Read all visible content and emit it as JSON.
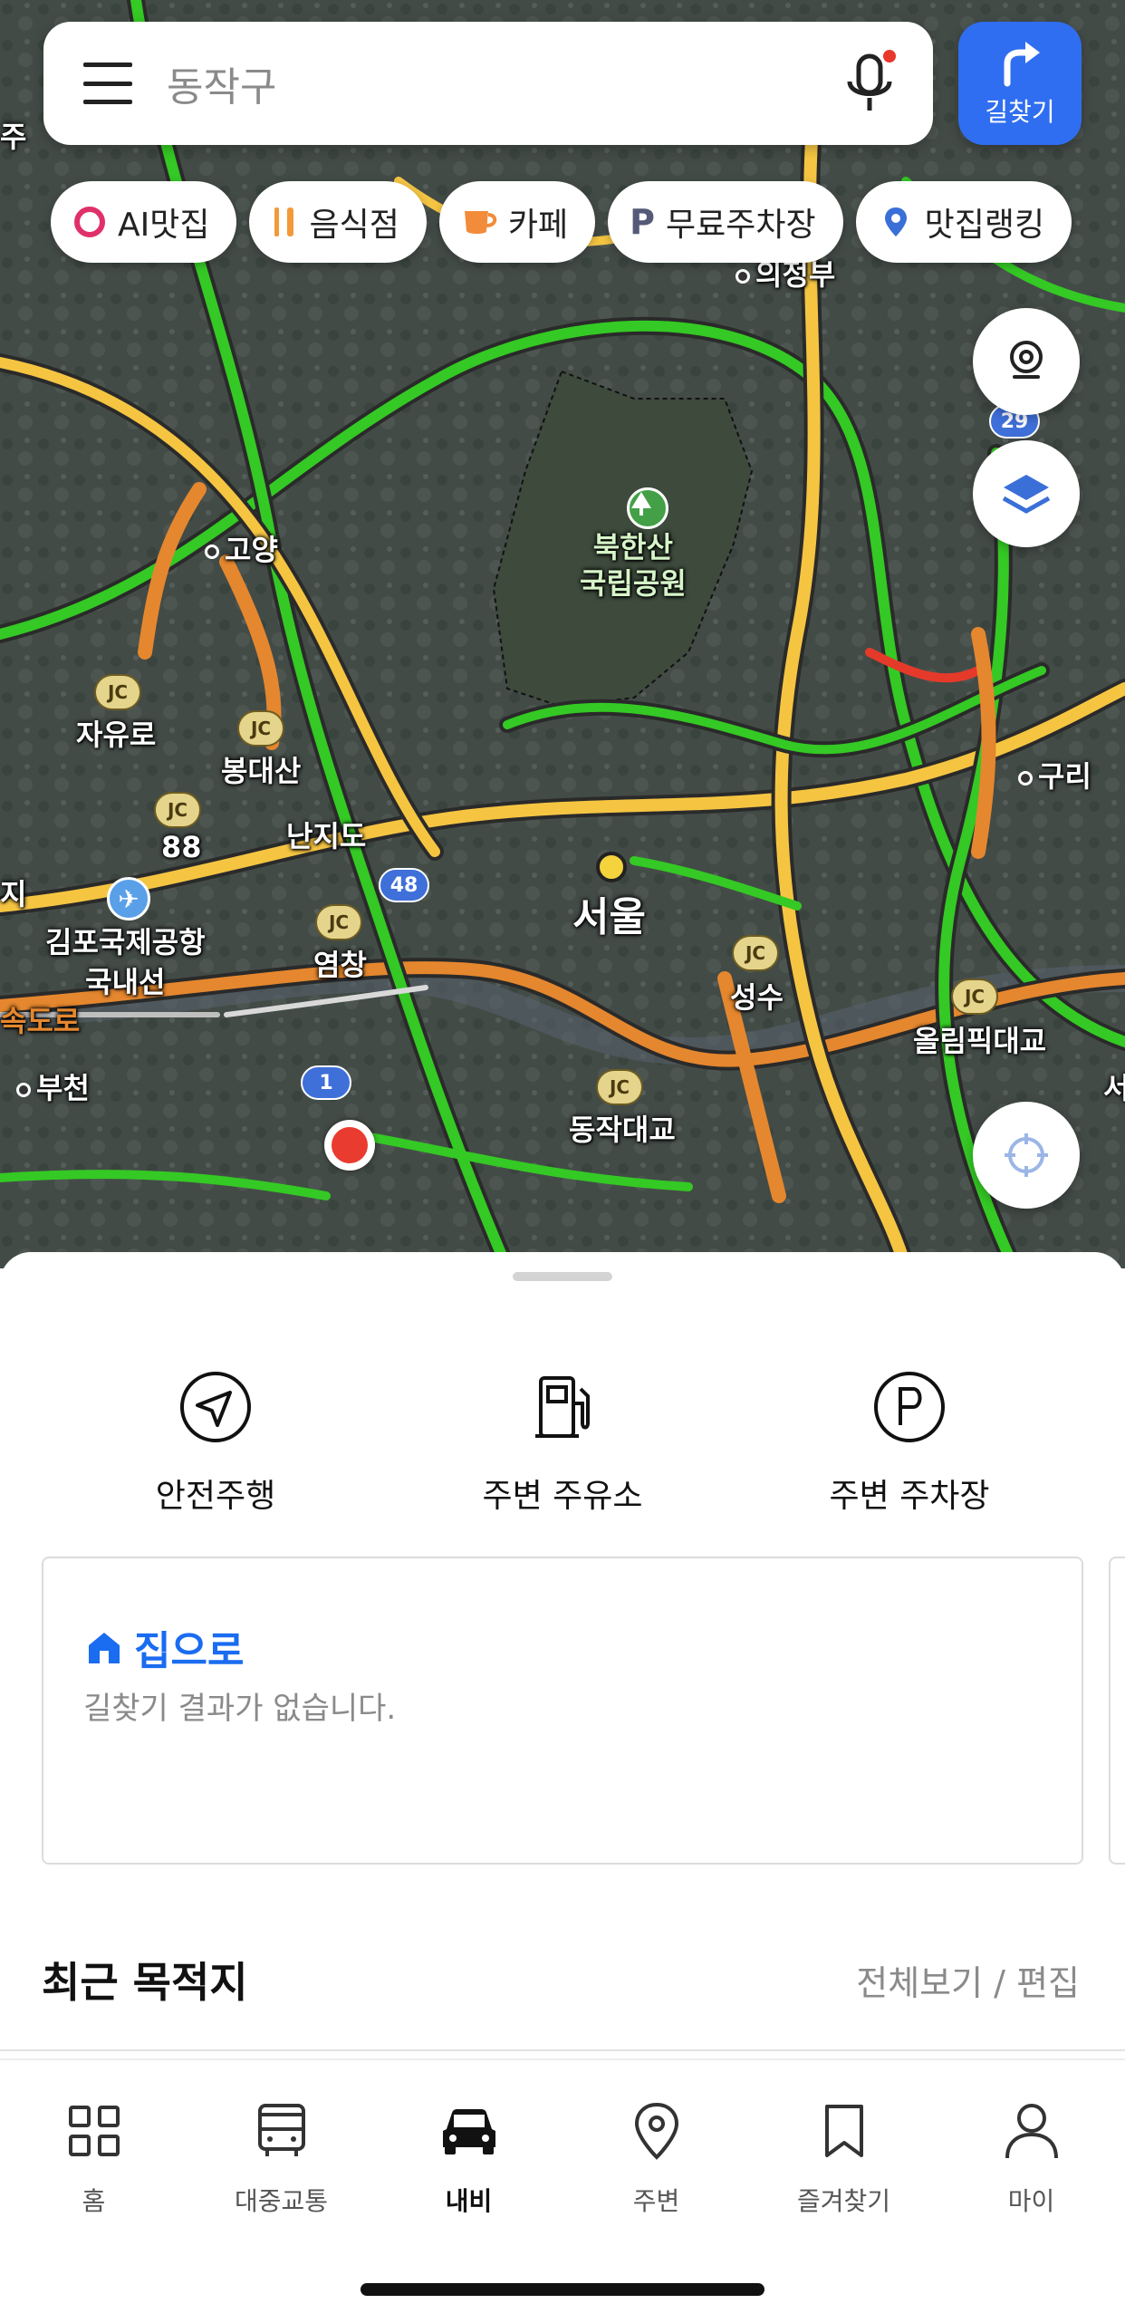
{
  "search": {
    "placeholder": "동작구"
  },
  "nav_button": {
    "label": "길찾기"
  },
  "chips": [
    {
      "icon": "ai-ring-icon",
      "label": "AI맛집"
    },
    {
      "icon": "fork-knife-icon",
      "label": "음식점"
    },
    {
      "icon": "coffee-cup-icon",
      "label": "카페"
    },
    {
      "icon": "parking-p-icon",
      "label": "무료주차장"
    },
    {
      "icon": "ranking-pin-icon",
      "label": "맛집랭킹"
    }
  ],
  "map": {
    "labels": {
      "goyang": "고양",
      "bukhansan": "북한산\n국립공원",
      "uijeongbu": "의정부",
      "jayuro": "자유로",
      "bongdaesan": "봉대산",
      "guri": "구리",
      "nanjido": "난지도",
      "seoul": "서울",
      "gimpo": "김포국제공항\n국내선",
      "yeomchang": "염창",
      "seongsu": "성수",
      "olympic": "올림픽대교",
      "bucheon": "부천",
      "dongjak": "동작대교",
      "route88": "88",
      "jc": "JC",
      "badge48": "48",
      "badge1": "1",
      "badge29": "29",
      "edge_ju": "주",
      "edge_ji": "지",
      "edge_sokdoro": "속도로",
      "edge_seo": "서"
    },
    "colors": {
      "satellite": "#3f4744",
      "traffic_green": "#34c924",
      "traffic_yellow": "#f5c542",
      "traffic_orange": "#e5872e",
      "traffic_red": "#e53a2a"
    }
  },
  "quick_actions": [
    {
      "icon": "navigation-arrow-icon",
      "label": "안전주행"
    },
    {
      "icon": "gas-station-icon",
      "label": "주변 주유소"
    },
    {
      "icon": "parking-icon",
      "label": "주변 주차장"
    }
  ],
  "home_card": {
    "title": "집으로",
    "subtitle": "길찾기 결과가 없습니다."
  },
  "recent": {
    "title": "최근 목적지",
    "links": "전체보기 / 편집"
  },
  "tabs": [
    {
      "icon": "grid-icon",
      "label": "홈",
      "active": false
    },
    {
      "icon": "bus-icon",
      "label": "대중교통",
      "active": false
    },
    {
      "icon": "car-icon",
      "label": "내비",
      "active": true
    },
    {
      "icon": "location-pin-icon",
      "label": "주변",
      "active": false
    },
    {
      "icon": "bookmark-icon",
      "label": "즐겨찾기",
      "active": false
    },
    {
      "icon": "person-icon",
      "label": "마이",
      "active": false
    }
  ]
}
